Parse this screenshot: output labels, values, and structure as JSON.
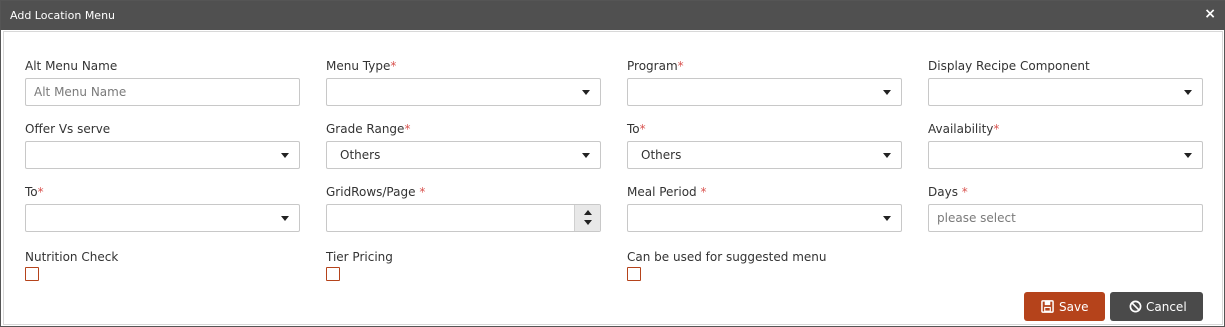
{
  "dialog": {
    "title": "Add Location Menu",
    "close_glyph": "×"
  },
  "fields": {
    "alt_menu_name": {
      "label": "Alt Menu Name",
      "required": false,
      "value": "",
      "placeholder": "Alt Menu Name"
    },
    "menu_type": {
      "label": "Menu Type",
      "required": true,
      "value": ""
    },
    "program": {
      "label": "Program",
      "required": true,
      "value": ""
    },
    "display_recipe_component": {
      "label": "Display Recipe Component",
      "required": false,
      "value": ""
    },
    "offer_vs_serve": {
      "label": "Offer Vs serve",
      "required": false,
      "value": ""
    },
    "grade_range": {
      "label": "Grade Range",
      "required": true,
      "value": "Others"
    },
    "grade_to": {
      "label": "To",
      "required": true,
      "value": "Others"
    },
    "availability": {
      "label": "Availability",
      "required": true,
      "value": ""
    },
    "availability_to": {
      "label": "To",
      "required": true,
      "value": ""
    },
    "grid_rows_page": {
      "label": "GridRows/Page ",
      "required": true,
      "value": ""
    },
    "meal_period": {
      "label": "Meal Period ",
      "required": true,
      "value": ""
    },
    "days": {
      "label": "Days ",
      "required": true,
      "value": "",
      "placeholder": "please select"
    }
  },
  "checkboxes": {
    "nutrition_check": {
      "label": "Nutrition Check",
      "checked": false
    },
    "tier_pricing": {
      "label": "Tier Pricing",
      "checked": false
    },
    "suggested_menu": {
      "label": "Can be used for suggested menu",
      "checked": false
    }
  },
  "buttons": {
    "save": {
      "label": "Save",
      "icon": "floppy-disk-icon"
    },
    "cancel": {
      "label": "Cancel",
      "icon": "ban-icon"
    }
  },
  "required_mark": "*",
  "colors": {
    "titlebar": "#505050",
    "accent": "#b5431b",
    "cancel": "#4a4a4a",
    "required": "#d9534f"
  }
}
